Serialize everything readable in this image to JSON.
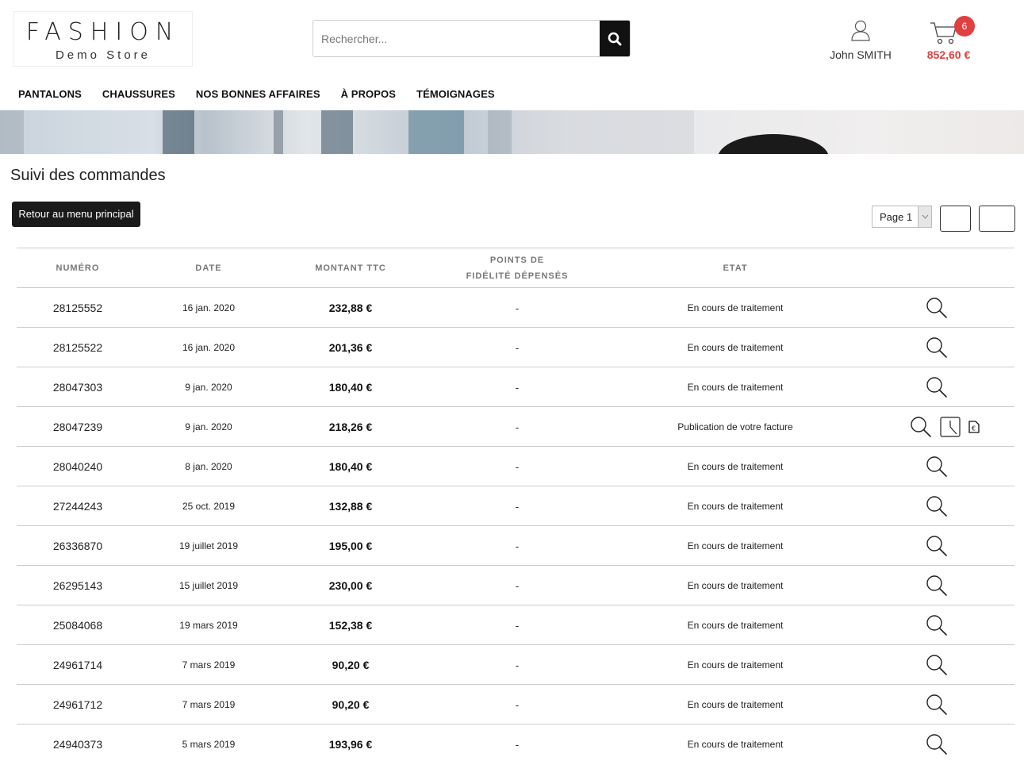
{
  "header": {
    "logo_main": "FASHION",
    "logo_sub": "Demo Store",
    "search_placeholder": "Rechercher...",
    "user_name": "John SMITH",
    "cart_count": "6",
    "cart_total": "852,60 €"
  },
  "nav": [
    "PANTALONS",
    "CHAUSSURES",
    "NOS BONNES AFFAIRES",
    "À PROPOS",
    "TÉMOIGNAGES"
  ],
  "page": {
    "title": "Suivi des commandes",
    "back_label": "Retour au menu principal",
    "pager_label": "Page 1"
  },
  "table": {
    "headers": {
      "number": "NUMÉRO",
      "date": "DATE",
      "amount": "MONTANT TTC",
      "points_line1": "POINTS DE",
      "points_line2": "FIDÉLITÉ DÉPENSÉS",
      "state": "ETAT"
    },
    "rows": [
      {
        "number": "28125552",
        "date": "16 jan. 2020",
        "amount": "232,88 €",
        "points": "-",
        "state": "En cours de traitement",
        "invoice": false
      },
      {
        "number": "28125522",
        "date": "16 jan. 2020",
        "amount": "201,36 €",
        "points": "-",
        "state": "En cours de traitement",
        "invoice": false
      },
      {
        "number": "28047303",
        "date": "9 jan. 2020",
        "amount": "180,40 €",
        "points": "-",
        "state": "En cours de traitement",
        "invoice": false
      },
      {
        "number": "28047239",
        "date": "9 jan. 2020",
        "amount": "218,26 €",
        "points": "-",
        "state": "Publication de votre facture",
        "invoice": true
      },
      {
        "number": "28040240",
        "date": "8 jan. 2020",
        "amount": "180,40 €",
        "points": "-",
        "state": "En cours de traitement",
        "invoice": false
      },
      {
        "number": "27244243",
        "date": "25 oct. 2019",
        "amount": "132,88 €",
        "points": "-",
        "state": "En cours de traitement",
        "invoice": false
      },
      {
        "number": "26336870",
        "date": "19 juillet 2019",
        "amount": "195,00 €",
        "points": "-",
        "state": "En cours de traitement",
        "invoice": false
      },
      {
        "number": "26295143",
        "date": "15 juillet 2019",
        "amount": "230,00 €",
        "points": "-",
        "state": "En cours de traitement",
        "invoice": false
      },
      {
        "number": "25084068",
        "date": "19 mars 2019",
        "amount": "152,38 €",
        "points": "-",
        "state": "En cours de traitement",
        "invoice": false
      },
      {
        "number": "24961714",
        "date": "7 mars 2019",
        "amount": "90,20 €",
        "points": "-",
        "state": "En cours de traitement",
        "invoice": false
      },
      {
        "number": "24961712",
        "date": "7 mars 2019",
        "amount": "90,20 €",
        "points": "-",
        "state": "En cours de traitement",
        "invoice": false
      },
      {
        "number": "24940373",
        "date": "5 mars 2019",
        "amount": "193,96 €",
        "points": "-",
        "state": "En cours de traitement",
        "invoice": false
      }
    ]
  },
  "colors": {
    "accent": "#e04040",
    "dark_button": "#1a1a1a"
  },
  "icons": {
    "search": "search-icon",
    "user": "user-icon",
    "cart": "cart-icon",
    "view": "magnifier-icon",
    "clock": "clock-icon",
    "invoice": "invoice-icon"
  }
}
